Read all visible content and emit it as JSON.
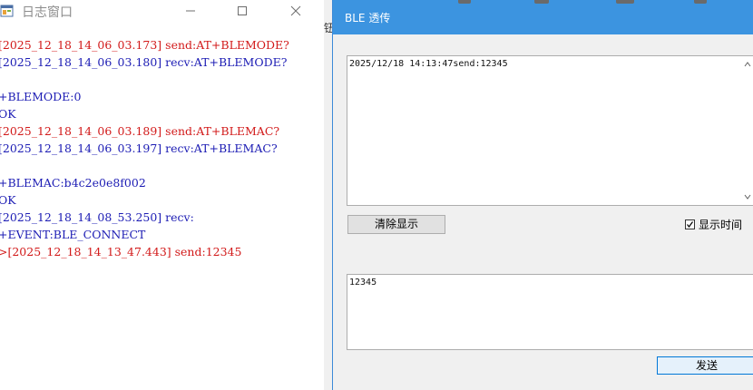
{
  "log_window": {
    "title": "日志窗口",
    "lines": [
      {
        "text": "[2025_12_18_14_06_03.173] send:AT+BLEMODE?",
        "type": "send"
      },
      {
        "text": "[2025_12_18_14_06_03.180] recv:AT+BLEMODE?",
        "type": "recv"
      },
      {
        "text": "",
        "type": "blank"
      },
      {
        "text": "+BLEMODE:0",
        "type": "resp"
      },
      {
        "text": "OK",
        "type": "resp"
      },
      {
        "text": "[2025_12_18_14_06_03.189] send:AT+BLEMAC?",
        "type": "send"
      },
      {
        "text": "[2025_12_18_14_06_03.197] recv:AT+BLEMAC?",
        "type": "recv"
      },
      {
        "text": "",
        "type": "blank"
      },
      {
        "text": "+BLEMAC:b4c2e0e8f002",
        "type": "resp"
      },
      {
        "text": "OK",
        "type": "resp"
      },
      {
        "text": "[2025_12_18_14_08_53.250] recv:",
        "type": "recv"
      },
      {
        "text": "+EVENT:BLE_CONNECT",
        "type": "resp"
      },
      {
        "text": ">[2025_12_18_14_13_47.443] send:12345",
        "type": "send"
      }
    ]
  },
  "ble_window": {
    "title": "BLE 透传",
    "receive_text": "2025/12/18 14:13:47send:12345",
    "clear_button_label": "清除显示",
    "show_time_label": "显示时间",
    "show_time_checked": true,
    "send_text": "12345",
    "send_button_label": "发送"
  },
  "background_peek_text": "钮",
  "colors": {
    "send_line": "#d21a1a",
    "recv_line": "#1c1cb4",
    "ble_titlebar": "#3c94e0"
  }
}
